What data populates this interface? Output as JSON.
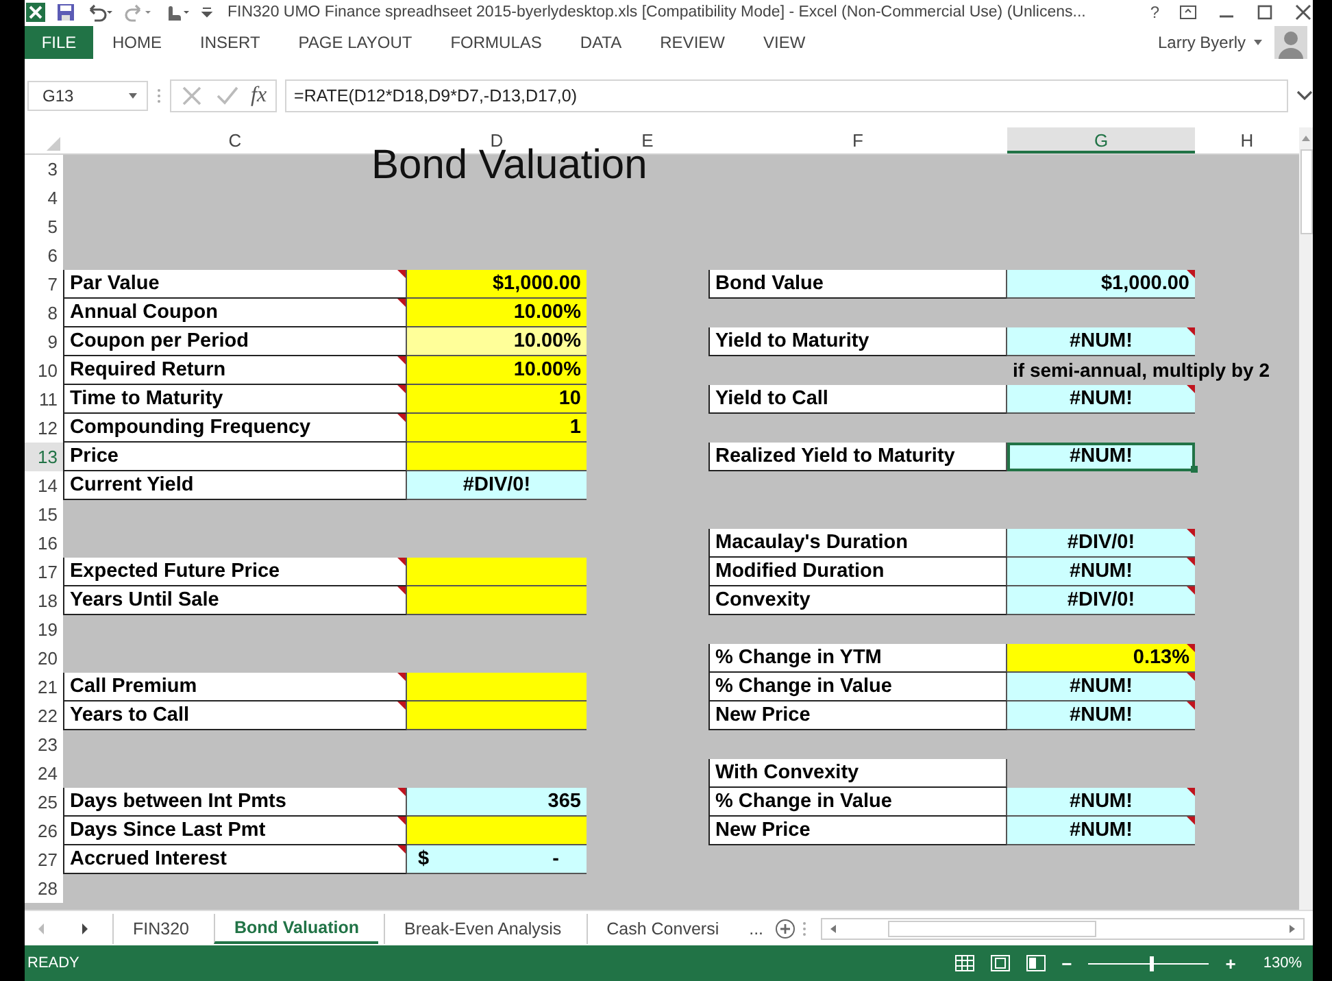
{
  "window": {
    "title": "FIN320 UMO Finance spreadhseet 2015-byerlydesktop.xls  [Compatibility Mode] - Excel (Non-Commercial Use) (Unlicens...",
    "help": "?"
  },
  "ribbon": {
    "tabs": [
      {
        "label": "FILE",
        "kind": "file",
        "selected": false
      },
      {
        "label": "HOME",
        "kind": "tab",
        "selected": false
      },
      {
        "label": "INSERT",
        "kind": "tab",
        "selected": false
      },
      {
        "label": "PAGE LAYOUT",
        "kind": "tab",
        "selected": false
      },
      {
        "label": "FORMULAS",
        "kind": "tab",
        "selected": false
      },
      {
        "label": "DATA",
        "kind": "tab",
        "selected": false
      },
      {
        "label": "REVIEW",
        "kind": "tab",
        "selected": false
      },
      {
        "label": "VIEW",
        "kind": "tab",
        "selected": false
      }
    ],
    "user": "Larry Byerly"
  },
  "formula_bar": {
    "name_box": "G13",
    "fx": "fx",
    "formula": "=RATE(D12*D18,D9*D7,-D13,D17,0)"
  },
  "columns": [
    {
      "letter": "C",
      "selected": false
    },
    {
      "letter": "D",
      "selected": false
    },
    {
      "letter": "E",
      "selected": false
    },
    {
      "letter": "F",
      "selected": false
    },
    {
      "letter": "G",
      "selected": true
    },
    {
      "letter": "H",
      "selected": false
    }
  ],
  "rows": [
    {
      "n": "3",
      "selected": false,
      "cells": {
        "D": {
          "kind": "title",
          "text": "Bond Valuation"
        }
      }
    },
    {
      "n": "4",
      "selected": false
    },
    {
      "n": "5",
      "selected": false
    },
    {
      "n": "6",
      "selected": false
    },
    {
      "n": "7",
      "selected": false,
      "cells": {
        "C": {
          "kind": "label",
          "text": "Par Value",
          "comment": true
        },
        "D": {
          "kind": "input",
          "text": "$1,000.00"
        },
        "F": {
          "kind": "label",
          "text": "Bond Value"
        },
        "G": {
          "kind": "value",
          "text": "$1,000.00",
          "comment": true
        }
      }
    },
    {
      "n": "8",
      "selected": false,
      "cells": {
        "C": {
          "kind": "label",
          "text": "Annual Coupon",
          "comment": true
        },
        "D": {
          "kind": "input",
          "text": "10.00%"
        }
      }
    },
    {
      "n": "9",
      "selected": false,
      "cells": {
        "C": {
          "kind": "label",
          "text": "Coupon per Period"
        },
        "D": {
          "kind": "input-pale",
          "text": "10.00%"
        },
        "F": {
          "kind": "label",
          "text": "Yield to Maturity"
        },
        "G": {
          "kind": "error",
          "text": "#NUM!",
          "comment": true
        }
      }
    },
    {
      "n": "10",
      "selected": false,
      "cells": {
        "C": {
          "kind": "label",
          "text": "Required Return",
          "comment": true
        },
        "D": {
          "kind": "input",
          "text": "10.00%"
        },
        "G": {
          "kind": "note",
          "text": "if semi-annual, multiply by 2"
        }
      }
    },
    {
      "n": "11",
      "selected": false,
      "cells": {
        "C": {
          "kind": "label",
          "text": "Time to Maturity",
          "comment": true
        },
        "D": {
          "kind": "input",
          "text": "10"
        },
        "F": {
          "kind": "label",
          "text": "Yield to Call"
        },
        "G": {
          "kind": "error",
          "text": "#NUM!",
          "comment": true
        }
      }
    },
    {
      "n": "12",
      "selected": false,
      "cells": {
        "C": {
          "kind": "label",
          "text": "Compounding Frequency",
          "comment": true
        },
        "D": {
          "kind": "input",
          "text": "1"
        }
      }
    },
    {
      "n": "13",
      "selected": true,
      "cells": {
        "C": {
          "kind": "label",
          "text": "Price"
        },
        "D": {
          "kind": "input"
        },
        "F": {
          "kind": "label",
          "text": "Realized Yield to Maturity"
        },
        "G": {
          "kind": "error",
          "text": "#NUM!",
          "selected": true
        }
      }
    },
    {
      "n": "14",
      "selected": false,
      "cells": {
        "C": {
          "kind": "label",
          "text": "Current Yield"
        },
        "D": {
          "kind": "error",
          "text": "#DIV/0!"
        }
      }
    },
    {
      "n": "15",
      "selected": false
    },
    {
      "n": "16",
      "selected": false,
      "cells": {
        "F": {
          "kind": "label",
          "text": "Macaulay's Duration"
        },
        "G": {
          "kind": "error",
          "text": "#DIV/0!",
          "comment": true
        }
      }
    },
    {
      "n": "17",
      "selected": false,
      "cells": {
        "C": {
          "kind": "label",
          "text": "Expected Future Price",
          "comment": true
        },
        "D": {
          "kind": "input"
        },
        "F": {
          "kind": "label",
          "text": "Modified Duration"
        },
        "G": {
          "kind": "error",
          "text": "#NUM!",
          "comment": true
        }
      }
    },
    {
      "n": "18",
      "selected": false,
      "cells": {
        "C": {
          "kind": "label",
          "text": "Years Until Sale",
          "comment": true
        },
        "D": {
          "kind": "input"
        },
        "F": {
          "kind": "label",
          "text": "Convexity"
        },
        "G": {
          "kind": "error",
          "text": "#DIV/0!",
          "comment": true
        }
      }
    },
    {
      "n": "19",
      "selected": false
    },
    {
      "n": "20",
      "selected": false,
      "cells": {
        "F": {
          "kind": "label",
          "text": "% Change in YTM"
        },
        "G": {
          "kind": "input",
          "text": "0.13%",
          "comment": true
        }
      }
    },
    {
      "n": "21",
      "selected": false,
      "cells": {
        "C": {
          "kind": "label",
          "text": "Call Premium",
          "comment": true
        },
        "D": {
          "kind": "input"
        },
        "F": {
          "kind": "label",
          "text": "% Change in Value"
        },
        "G": {
          "kind": "error",
          "text": "#NUM!",
          "comment": true
        }
      }
    },
    {
      "n": "22",
      "selected": false,
      "cells": {
        "C": {
          "kind": "label",
          "text": "Years to Call",
          "comment": true
        },
        "D": {
          "kind": "input"
        },
        "F": {
          "kind": "label",
          "text": "New Price"
        },
        "G": {
          "kind": "error",
          "text": "#NUM!",
          "comment": true
        }
      }
    },
    {
      "n": "23",
      "selected": false
    },
    {
      "n": "24",
      "selected": false,
      "cells": {
        "F": {
          "kind": "label",
          "text": "With Convexity"
        }
      }
    },
    {
      "n": "25",
      "selected": false,
      "cells": {
        "C": {
          "kind": "label",
          "text": "Days between Int Pmts",
          "comment": true
        },
        "D": {
          "kind": "value",
          "text": "365"
        },
        "F": {
          "kind": "label",
          "text": "% Change in Value"
        },
        "G": {
          "kind": "error",
          "text": "#NUM!",
          "comment": true
        }
      }
    },
    {
      "n": "26",
      "selected": false,
      "cells": {
        "C": {
          "kind": "label",
          "text": "Days Since Last Pmt",
          "comment": true
        },
        "D": {
          "kind": "input"
        },
        "F": {
          "kind": "label",
          "text": "New Price"
        },
        "G": {
          "kind": "error",
          "text": "#NUM!",
          "comment": true
        }
      }
    },
    {
      "n": "27",
      "selected": false,
      "cells": {
        "C": {
          "kind": "label",
          "text": "Accrued Interest",
          "comment": true
        },
        "D": {
          "kind": "currency",
          "text": "$",
          "amount": "-"
        }
      }
    },
    {
      "n": "28",
      "selected": false
    }
  ],
  "sheet_tabs": [
    {
      "label": "FIN320",
      "selected": false
    },
    {
      "label": "Bond Valuation",
      "selected": true
    },
    {
      "label": "Break-Even Analysis",
      "selected": false
    },
    {
      "label": "Cash Conversi",
      "selected": false
    }
  ],
  "more_tabs": "...",
  "status_bar": {
    "status": "READY",
    "zoom": {
      "minus": "−",
      "level": 0.52,
      "plus": "+",
      "reading": "130%"
    }
  }
}
